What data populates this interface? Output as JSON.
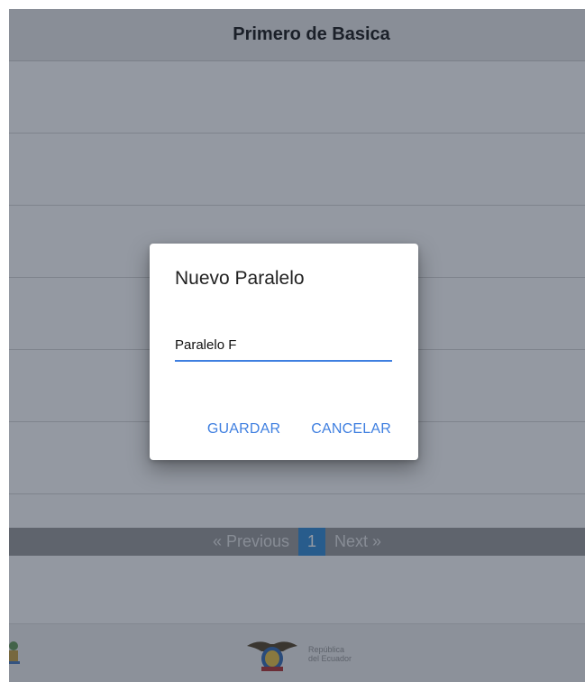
{
  "header": {
    "title": "Primero de Basica"
  },
  "list": {
    "rows": 6
  },
  "pagination": {
    "previous_label": "« Previous",
    "current_page": "1",
    "next_label": "Next »"
  },
  "footer": {
    "logo_line1": "República",
    "logo_line2": "del Ecuador",
    "left_icon": "emblem-icon",
    "logo_icon": "coat-of-arms-icon"
  },
  "dialog": {
    "title": "Nuevo Paralelo",
    "input_value": "Paralelo F",
    "save_label": "GUARDAR",
    "cancel_label": "CANCELAR"
  },
  "colors": {
    "accent": "#3f7fe0",
    "current_page_bg": "#3a8fd6",
    "overlay": "rgba(20,32,52,0.45)"
  }
}
